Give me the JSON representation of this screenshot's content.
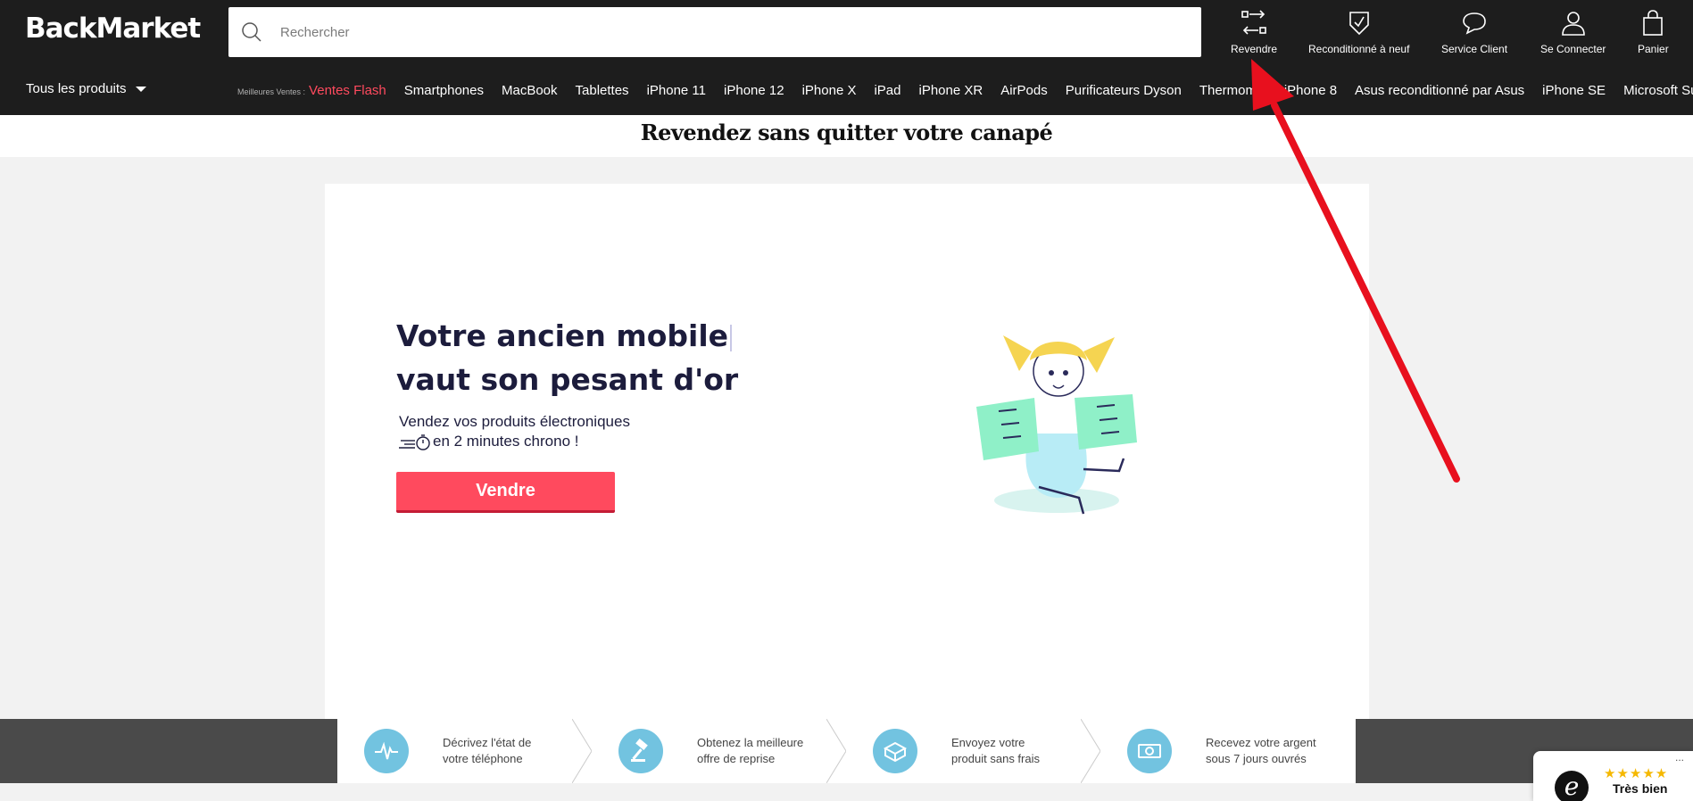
{
  "header": {
    "logo": "BackMarket",
    "search_placeholder": "Rechercher",
    "tools": [
      {
        "label": "Revendre",
        "icon": "resell-arrows-icon"
      },
      {
        "label": "Reconditionné à neuf",
        "icon": "shield-check-icon"
      },
      {
        "label": "Service Client",
        "icon": "chat-bubble-icon"
      },
      {
        "label": "Se Connecter",
        "icon": "user-icon"
      },
      {
        "label": "Panier",
        "icon": "bag-icon"
      }
    ]
  },
  "nav": {
    "all_products": "Tous les produits",
    "best_label": "Meilleures Ventes :",
    "flash": "Ventes Flash",
    "links": [
      "Smartphones",
      "MacBook",
      "Tablettes",
      "iPhone 11",
      "iPhone 12",
      "iPhone X",
      "iPad",
      "iPhone XR",
      "AirPods",
      "Purificateurs Dyson",
      "Thermomix",
      "iPhone 8",
      "Asus reconditionné par Asus",
      "iPhone SE",
      "Microsoft Surface"
    ]
  },
  "band": {
    "title": "Revendez sans quitter votre canapé"
  },
  "hero": {
    "title_line1": "Votre ancien mobile",
    "title_line2": "vaut son pesant d'or",
    "sub_line1": "Vendez vos produits électroniques",
    "sub_line2": "en 2 minutes chrono !",
    "button": "Vendre"
  },
  "steps": [
    {
      "line1": "Décrivez l'état de",
      "line2": "votre téléphone",
      "icon": "heartbeat-icon"
    },
    {
      "line1": "Obtenez la meilleure",
      "line2": "offre de reprise",
      "icon": "gavel-icon"
    },
    {
      "line1": "Envoyez votre",
      "line2": "produit sans frais",
      "icon": "package-icon"
    },
    {
      "line1": "Recevez votre argent",
      "line2": "sous 7 jours ouvrés",
      "icon": "banknote-icon"
    }
  ],
  "trust": {
    "stars": "★★★★★",
    "rating": "Très bien",
    "logo_letter": "e",
    "menu": "..."
  },
  "colors": {
    "header_bg": "#1d1d1d",
    "accent_red": "#ff4a5e",
    "step_icon": "#72c3e0",
    "annotation_arrow": "#e8101e"
  }
}
